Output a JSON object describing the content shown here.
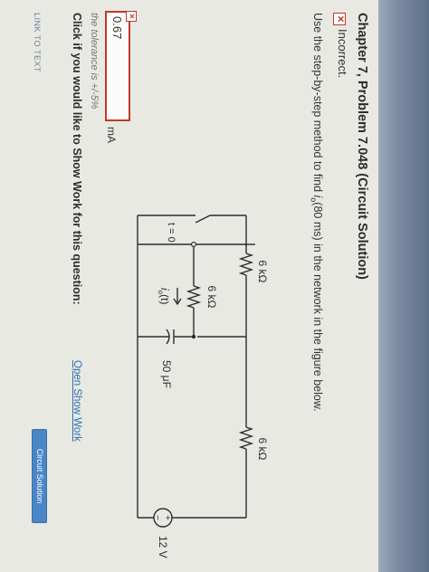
{
  "problem": {
    "title": "Chapter 7, Problem 7.048 (Circuit Solution)",
    "status_label": "Incorrect.",
    "prompt_prefix": "Use the step-by-step method to find ",
    "prompt_var": "i",
    "prompt_sub": "o",
    "prompt_suffix": "(80 ms) in the network in the figure below."
  },
  "circuit": {
    "r_top_left": "6 kΩ",
    "r_middle": "6 kΩ",
    "r_top_right": "6 kΩ",
    "source": "12 V",
    "capacitor": "50 μF",
    "current_label": "i",
    "current_sub": "o",
    "current_suffix": "(t)",
    "switch_label": "t = 0",
    "source_plus": "+",
    "source_minus": "−"
  },
  "answer": {
    "value": "0.67",
    "unit": "mA",
    "tolerance": "the tolerance is +/-5%"
  },
  "show_work": {
    "question": "Click if you would like to Show Work for this question:",
    "link": "Open Show Work"
  },
  "footer": {
    "link_to_text": "LINK TO TEXT",
    "circuit_button": "Circuit Solution"
  }
}
